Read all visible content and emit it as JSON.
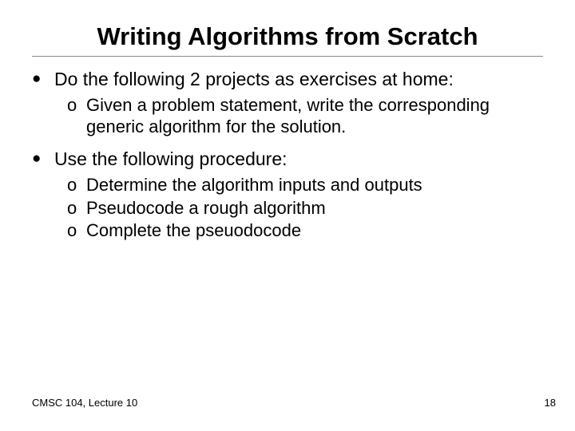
{
  "title": "Writing Algorithms from Scratch",
  "items": [
    {
      "text": "Do the following 2 projects as exercises at home:",
      "sub": [
        "Given a problem statement, write the corresponding generic algorithm for the solution."
      ]
    },
    {
      "text": "Use the following procedure:",
      "sub": [
        "Determine the algorithm inputs and outputs",
        "Pseudocode a rough algorithm",
        "Complete the pseuodocode"
      ]
    }
  ],
  "footer": {
    "left": "CMSC 104, Lecture 10",
    "right": "18"
  },
  "glyphs": {
    "dot": "●",
    "oh": "o"
  }
}
